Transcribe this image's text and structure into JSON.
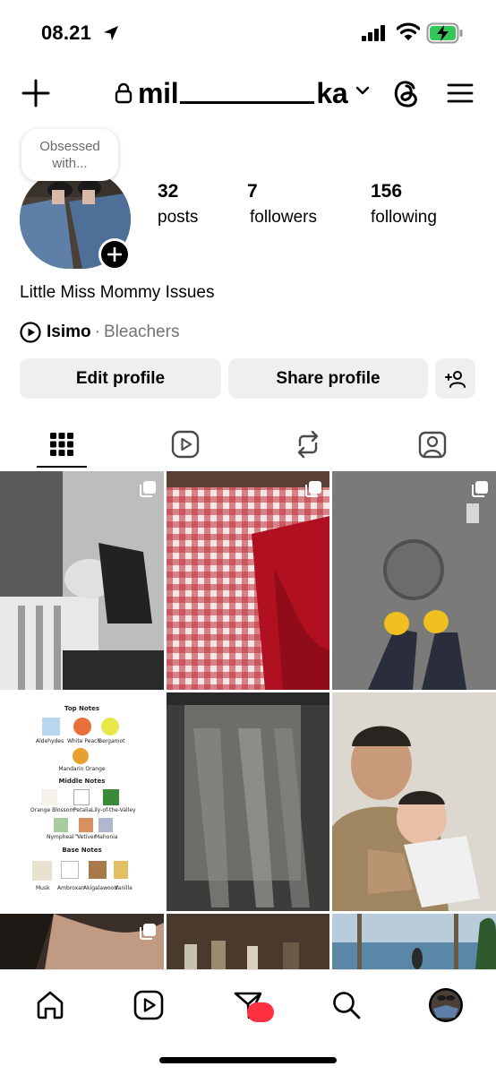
{
  "status_bar": {
    "time": "08.21"
  },
  "header": {
    "username_prefix": "mil",
    "username_suffix": "ka",
    "icons": [
      "plus-icon",
      "lock-icon",
      "chevron-down-icon",
      "threads-icon",
      "menu-icon"
    ]
  },
  "profile": {
    "note": "Obsessed with...",
    "stats": {
      "posts": {
        "count": "32",
        "label": "posts"
      },
      "followers": {
        "count": "7",
        "label": "followers"
      },
      "following": {
        "count": "156",
        "label": "following"
      }
    },
    "bio": "Little Miss Mommy Issues",
    "music": {
      "song": "Isimo",
      "separator": "·",
      "artist": "Bleachers"
    }
  },
  "buttons": {
    "edit_profile": "Edit profile",
    "share_profile": "Share profile"
  },
  "tabs": [
    "grid",
    "reels",
    "reposts",
    "tagged"
  ],
  "perfume_card": {
    "top_title": "Top Notes",
    "top_items": [
      "Aldehydes",
      "White Peach",
      "Bergamot",
      "Mandarin Orange"
    ],
    "middle_title": "Middle Notes",
    "middle_items": [
      "Orange Blossom",
      "Petalia",
      "Lily-of-the-Valley",
      "Nympheal™",
      "Vetiver",
      "Mahonia"
    ],
    "base_title": "Base Notes",
    "base_items": [
      "Musk",
      "Ambroxan",
      "Akigalawood",
      "Vanilla"
    ]
  },
  "bottom_nav": [
    "home-icon",
    "reels-icon",
    "messages-icon",
    "search-icon",
    "profile-avatar"
  ],
  "colors": {
    "notification": "#ff3040",
    "button_bg": "#efefef",
    "battery_fill": "#34c759"
  }
}
